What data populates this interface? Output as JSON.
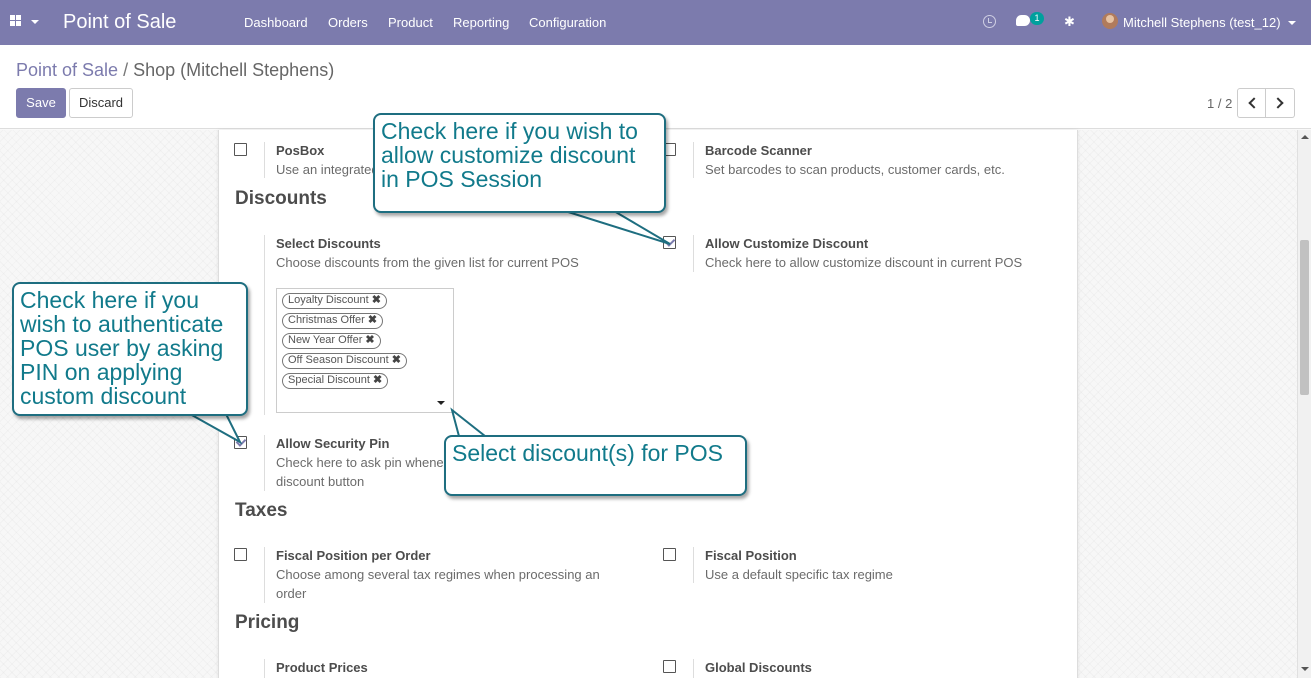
{
  "navbar": {
    "brand": "Point of Sale",
    "menu": [
      "Dashboard",
      "Orders",
      "Product",
      "Reporting",
      "Configuration"
    ],
    "chat_count": "1",
    "user": "Mitchell Stephens (test_12)",
    "bg_color": "#7c7bad"
  },
  "breadcrumb": {
    "parent": "Point of Sale",
    "separator": "/",
    "current": "Shop (Mitchell Stephens)"
  },
  "buttons": {
    "save": "Save",
    "discard": "Discard"
  },
  "pager": {
    "value": "1 / 2"
  },
  "sections": {
    "discounts": "Discounts",
    "taxes": "Taxes",
    "pricing": "Pricing"
  },
  "settings": {
    "posbox": {
      "title": "PosBox",
      "desc": "Use an integrated"
    },
    "barcode": {
      "title": "Barcode Scanner",
      "desc": "Set barcodes to scan products, customer cards, etc."
    },
    "select_discounts": {
      "title": "Select Discounts",
      "desc": "Choose discounts from the given list for current POS"
    },
    "allow_customize": {
      "title": "Allow Customize Discount",
      "desc": "Check here to allow customize discount in current POS",
      "checked": true
    },
    "security_pin": {
      "title": "Allow Security Pin",
      "desc_line1": "Check here to ask pin whene",
      "desc_line2": "discount button",
      "checked": true
    },
    "fiscal_per_order": {
      "title": "Fiscal Position per Order",
      "desc_line1": "Choose among several tax regimes when processing an",
      "desc_line2": "order"
    },
    "fiscal_position": {
      "title": "Fiscal Position",
      "desc": "Use a default specific tax regime"
    },
    "product_prices": {
      "title": "Product Prices"
    },
    "global_discounts": {
      "title": "Global Discounts"
    }
  },
  "discount_tags": [
    "Loyalty Discount",
    "Christmas Offer",
    "New Year Offer",
    "Off Season Discount",
    "Special Discount"
  ],
  "callouts": {
    "customize": [
      "Check here if you wish to",
      "allow customize discount",
      "in POS Session"
    ],
    "pin": [
      "Check here if you",
      "wish to authenticate",
      "POS user by asking",
      "PIN on applying",
      "custom discount"
    ],
    "select": [
      "Select discount(s) for POS"
    ]
  }
}
